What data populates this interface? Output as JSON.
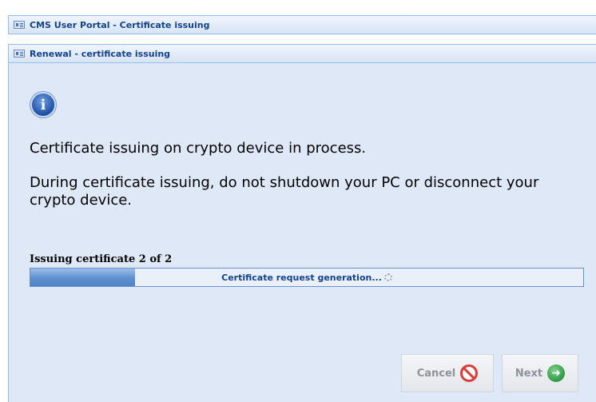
{
  "window": {
    "title": "CMS User Portal - Certificate issuing"
  },
  "dialog": {
    "title": "Renewal - certificate issuing"
  },
  "message": {
    "line1": "Certificate issuing on crypto device in process.",
    "line2": "During certificate issuing, do not shutdown your PC or disconnect your crypto device."
  },
  "progress": {
    "label": "Issuing certificate 2 of 2",
    "status_text": "Certificate request generation...",
    "fill_fraction": 0.19
  },
  "buttons": {
    "cancel_label": "Cancel",
    "next_label": "Next"
  },
  "icons": {
    "info": "info-icon",
    "spinner": "loading-spinner-icon",
    "cancel": "stop-icon",
    "next": "arrow-right-circle-icon"
  },
  "colors": {
    "title_text": "#15428b",
    "panel_bg": "#dfe8f6",
    "progress_fill": "#5e8fd0",
    "cancel_icon": "#dd3b3b",
    "next_icon": "#2e9a44"
  }
}
